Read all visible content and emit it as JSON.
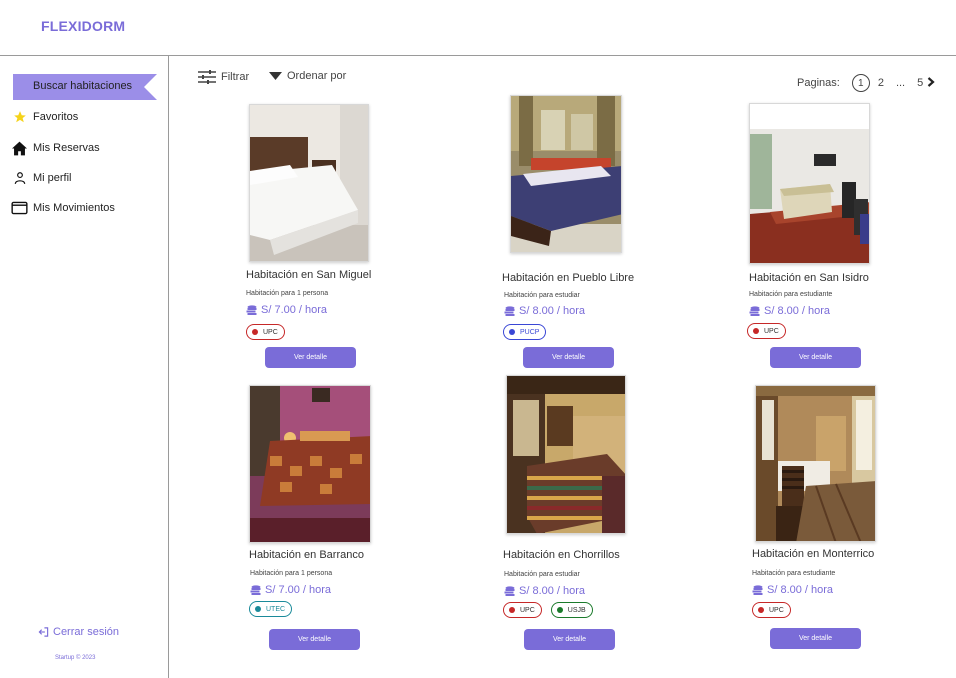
{
  "app": {
    "logo": "FLEXIDORM"
  },
  "sidebar": {
    "items": [
      {
        "label": "Buscar habitaciones",
        "icon": "flag-banner",
        "active": true
      },
      {
        "label": "Favoritos",
        "icon": "star-icon"
      },
      {
        "label": "Mis Reservas",
        "icon": "home-icon"
      },
      {
        "label": "Mi perfil",
        "icon": "user-icon"
      },
      {
        "label": "Mis Movimientos",
        "icon": "wallet-icon"
      }
    ],
    "logout": "Cerrar sesión",
    "copyright": "Startup © 2023"
  },
  "toolbar": {
    "filter": "Filtrar",
    "sort": "Ordenar por"
  },
  "pagination": {
    "label": "Paginas:",
    "current": "1",
    "next": "2",
    "ellipsis": "...",
    "last": "5"
  },
  "colors": {
    "accent": "#7a6cd8",
    "accent_light": "#9b8ee8",
    "upc": "#c62828",
    "pucp": "#3a47d5",
    "utec": "#1a8a9a",
    "usjb": "#1b7a2b"
  },
  "rooms": [
    {
      "title": "Habitación en San Miguel",
      "subtitle": "Habitación para 1 persona",
      "price": "S/ 7.00 / hora",
      "tags": [
        {
          "label": "UPC",
          "color": "upc"
        }
      ],
      "button": "Ver detalle"
    },
    {
      "title": "Habitación en Pueblo Libre",
      "subtitle": "Habitación para estudiar",
      "price": "S/ 8.00 / hora",
      "tags": [
        {
          "label": "PUCP",
          "color": "pucp"
        }
      ],
      "button": "Ver detalle"
    },
    {
      "title": "Habitación en San Isidro",
      "subtitle": "Habitación para estudiante",
      "price": "S/ 8.00 / hora",
      "tags": [
        {
          "label": "UPC",
          "color": "upc"
        }
      ],
      "button": "Ver detalle"
    },
    {
      "title": "Habitación en Barranco",
      "subtitle": "Habitación para 1 persona",
      "price": "S/ 7.00 / hora",
      "tags": [
        {
          "label": "UTEC",
          "color": "utec"
        }
      ],
      "button": "Ver detalle"
    },
    {
      "title": "Habitación en Chorrillos",
      "subtitle": "Habitación para estudiar",
      "price": "S/ 8.00 / hora",
      "tags": [
        {
          "label": "UPC",
          "color": "upc"
        },
        {
          "label": "USJB",
          "color": "usjb"
        }
      ],
      "button": "Ver detalle"
    },
    {
      "title": "Habitación en Monterrico",
      "subtitle": "Habitación para estudiante",
      "price": "S/ 8.00 / hora",
      "tags": [
        {
          "label": "UPC",
          "color": "upc"
        }
      ],
      "button": "Ver detalle"
    }
  ]
}
